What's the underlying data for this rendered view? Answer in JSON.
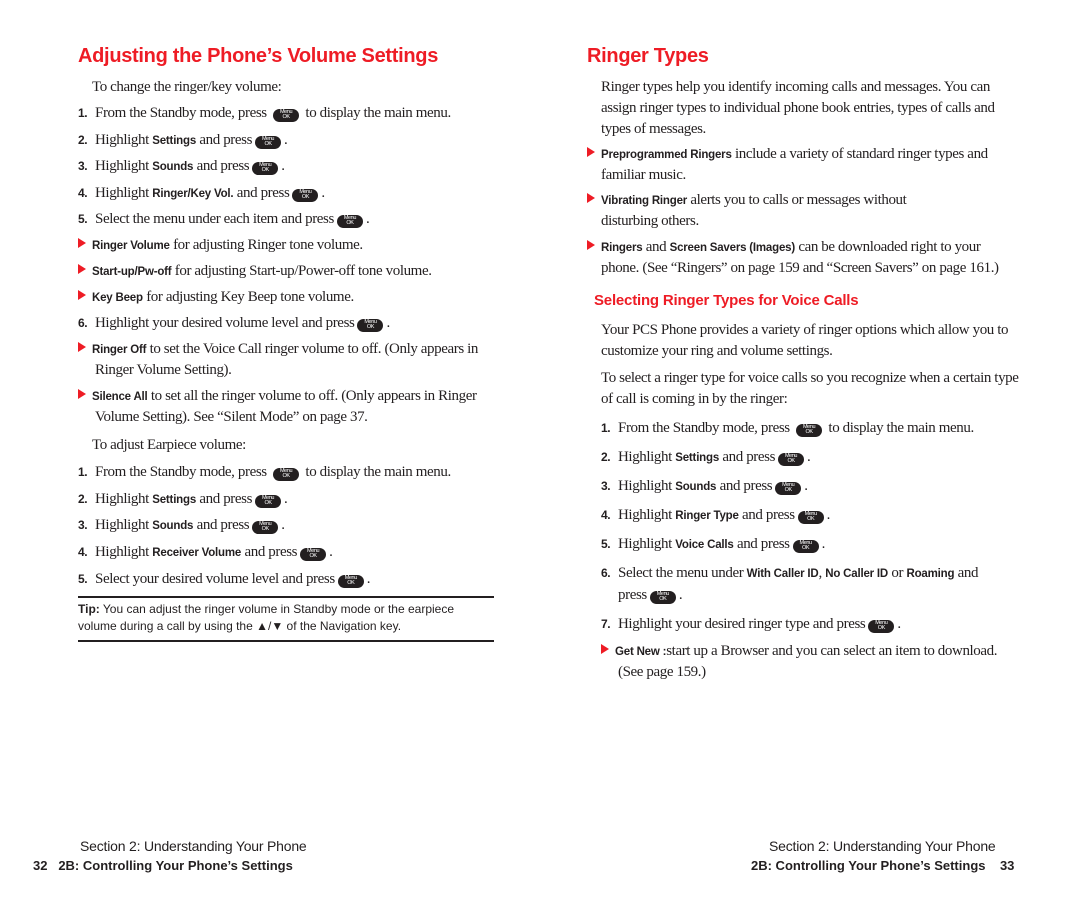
{
  "left_page": {
    "title": "Adjusting the Phone’s Volume Settings",
    "intro_ringer": "To change the ringer/key volume:",
    "steps_a": [
      {
        "n": "1.",
        "pre": "From the Standby mode, press",
        "bold": "",
        "post": "to display the main menu.",
        "key": true
      },
      {
        "n": "2.",
        "pre": "Highlight",
        "bold": "Settings",
        "post": "and press",
        "key": true
      },
      {
        "n": "3.",
        "pre": "Highlight",
        "bold": "Sounds",
        "post": "and press",
        "key": true
      },
      {
        "n": "4.",
        "pre": "Highlight",
        "bold": "Ringer/Key Vol.",
        "post": "and press",
        "key": true
      },
      {
        "n": "5.",
        "pre": "Select the menu under each item and press",
        "bold": "",
        "post": "",
        "key": true
      }
    ],
    "bullets_a": [
      {
        "bold": "Ringer Volume",
        "text": "for adjusting Ringer tone volume."
      },
      {
        "bold": "Start-up/Pw-off",
        "text": "for adjusting Start-up/Power-off tone volume."
      },
      {
        "bold": "Key Beep",
        "text": "for adjusting Key Beep tone volume."
      }
    ],
    "step6": {
      "n": "6.",
      "pre": "Highlight your desired volume level and press"
    },
    "bullets_b": [
      {
        "bold": "Ringer Off",
        "text": "to set the Voice Call ringer volume to off. (Only appears in",
        "cont": "Ringer Volume Setting)."
      },
      {
        "bold": "Silence All",
        "text": "to set all the ringer volume to off. (Only appears in Ringer",
        "cont": "Volume Setting). See “Silent Mode” on page 37."
      }
    ],
    "intro_earpiece": "To adjust Earpiece volume:",
    "steps_b": [
      {
        "n": "1.",
        "pre": "From the Standby mode, press",
        "bold": "",
        "post": "to display the main menu."
      },
      {
        "n": "2.",
        "pre": "Highlight",
        "bold": "Settings",
        "post": "and press"
      },
      {
        "n": "3.",
        "pre": "Highlight",
        "bold": "Sounds",
        "post": "and press"
      },
      {
        "n": "4.",
        "pre": "Highlight",
        "bold": "Receiver Volume",
        "post": "and press"
      },
      {
        "n": "5.",
        "pre": "Select your desired volume level and press",
        "bold": "",
        "post": ""
      }
    ],
    "tip": {
      "label": "Tip:",
      "line1": "You can adjust the ringer volume in Standby mode or the earpiece",
      "line2": "volume during a call by using the ▲/▼ of the Navigation key."
    },
    "footer": {
      "section": "Section 2: Understanding Your Phone",
      "page_number": "32",
      "chapter": "2B: Controlling Your Phone’s Settings"
    }
  },
  "right_page": {
    "title": "Ringer Types",
    "intro": [
      "Ringer types help you identify incoming calls and messages. You can",
      "assign ringer types to individual phone book entries, types of calls and",
      "types of messages."
    ],
    "bullets": [
      {
        "bold": "Preprogrammed Ringers",
        "text": "include a variety of standard ringer types and",
        "cont": "familiar music."
      },
      {
        "bold": "Vibrating Ringer",
        "text": "alerts you to calls or messages without",
        "cont": "disturbing others."
      },
      {
        "bold": "Ringers",
        "mid": "and",
        "bold2": "Screen Savers (Images)",
        "text": "can be downloaded right to your",
        "cont": "phone. (See “Ringers” on page 159 and “Screen Savers” on page 161.)"
      }
    ],
    "subheading": "Selecting Ringer Types for Voice Calls",
    "para1": [
      "Your PCS Phone provides a variety of ringer options which allow you to",
      "customize your ring and volume settings."
    ],
    "para2": [
      "To select a ringer type for voice calls so you recognize when a certain type",
      "of call is coming in by the ringer:"
    ],
    "steps": [
      {
        "n": "1.",
        "pre": "From the Standby mode, press",
        "bold": "",
        "post": "to display the main menu."
      },
      {
        "n": "2.",
        "pre": "Highlight",
        "bold": "Settings",
        "post": "and press"
      },
      {
        "n": "3.",
        "pre": "Highlight",
        "bold": "Sounds",
        "post": "and press"
      },
      {
        "n": "4.",
        "pre": "Highlight",
        "bold": "Ringer Type",
        "post": "and press"
      },
      {
        "n": "5.",
        "pre": "Highlight",
        "bold": "Voice Calls",
        "post": "and press"
      }
    ],
    "step6": {
      "n": "6.",
      "pre": "Select the menu under",
      "b1": "With Caller ID",
      "sep": ",",
      "b2": "No Caller ID",
      "or": "or",
      "b3": "Roaming",
      "post": "and",
      "cont": "press"
    },
    "step7": {
      "n": "7.",
      "pre": "Highlight your desired ringer type and press"
    },
    "getnew": {
      "bold": "Get New :",
      "text": "start up a Browser and you can select an item to download.",
      "cont": "(See page 159.)"
    },
    "footer": {
      "section": "Section 2: Understanding Your Phone",
      "chapter": "2B: Controlling Your Phone’s Settings",
      "page_number": "33"
    }
  },
  "key_icon": {
    "top": "Menu",
    "bottom": "OK"
  },
  "accent_color": "#ee1c25"
}
